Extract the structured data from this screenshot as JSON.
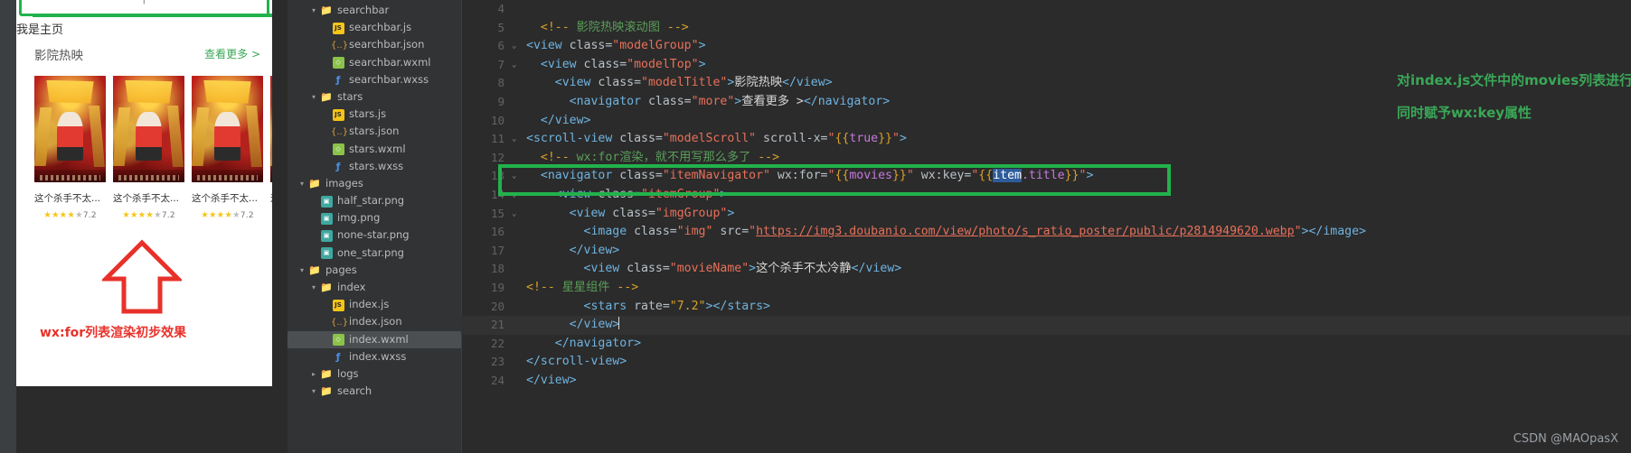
{
  "simulator": {
    "search_placeholder": "",
    "search_icon": "search-icon",
    "home_label": "我是主页",
    "model_title": "影院热映",
    "more_label": "查看更多 >",
    "movies": [
      {
        "title": "这个杀手不太...",
        "rate": "7.2"
      },
      {
        "title": "这个杀手不太...",
        "rate": "7.2"
      },
      {
        "title": "这个杀手不太...",
        "rate": "7.2"
      },
      {
        "title": "这",
        "rate": ""
      }
    ],
    "stars_filled": 4,
    "stars_empty": 1,
    "annotation": "wx:for列表渲染初步效果"
  },
  "explorer": {
    "items": [
      {
        "label": "searchbar",
        "indent": 1,
        "type": "folder",
        "arrow": "▾",
        "selected": false
      },
      {
        "label": "searchbar.js",
        "indent": 2,
        "type": "js",
        "arrow": "",
        "selected": false
      },
      {
        "label": "searchbar.json",
        "indent": 2,
        "type": "json",
        "arrow": "",
        "selected": false
      },
      {
        "label": "searchbar.wxml",
        "indent": 2,
        "type": "wxml",
        "arrow": "",
        "selected": false
      },
      {
        "label": "searchbar.wxss",
        "indent": 2,
        "type": "wxss",
        "arrow": "",
        "selected": false
      },
      {
        "label": "stars",
        "indent": 1,
        "type": "folder",
        "arrow": "▾",
        "selected": false
      },
      {
        "label": "stars.js",
        "indent": 2,
        "type": "js",
        "arrow": "",
        "selected": false
      },
      {
        "label": "stars.json",
        "indent": 2,
        "type": "json",
        "arrow": "",
        "selected": false
      },
      {
        "label": "stars.wxml",
        "indent": 2,
        "type": "wxml",
        "arrow": "",
        "selected": false
      },
      {
        "label": "stars.wxss",
        "indent": 2,
        "type": "wxss",
        "arrow": "",
        "selected": false
      },
      {
        "label": "images",
        "indent": 0,
        "type": "folder-t",
        "arrow": "▾",
        "selected": false
      },
      {
        "label": "half_star.png",
        "indent": 1,
        "type": "png",
        "arrow": "",
        "selected": false
      },
      {
        "label": "img.png",
        "indent": 1,
        "type": "png",
        "arrow": "",
        "selected": false
      },
      {
        "label": "none-star.png",
        "indent": 1,
        "type": "png",
        "arrow": "",
        "selected": false
      },
      {
        "label": "one_star.png",
        "indent": 1,
        "type": "png",
        "arrow": "",
        "selected": false
      },
      {
        "label": "pages",
        "indent": 0,
        "type": "folder-r",
        "arrow": "▾",
        "selected": false
      },
      {
        "label": "index",
        "indent": 1,
        "type": "folder",
        "arrow": "▾",
        "selected": false
      },
      {
        "label": "index.js",
        "indent": 2,
        "type": "js",
        "arrow": "",
        "selected": false
      },
      {
        "label": "index.json",
        "indent": 2,
        "type": "json",
        "arrow": "",
        "selected": false
      },
      {
        "label": "index.wxml",
        "indent": 2,
        "type": "wxml",
        "arrow": "",
        "selected": true
      },
      {
        "label": "index.wxss",
        "indent": 2,
        "type": "wxss",
        "arrow": "",
        "selected": false
      },
      {
        "label": "logs",
        "indent": 1,
        "type": "folder-y",
        "arrow": "▸",
        "selected": false
      },
      {
        "label": "search",
        "indent": 1,
        "type": "folder",
        "arrow": "▾",
        "selected": false
      }
    ]
  },
  "editor": {
    "lines": [
      {
        "n": "4",
        "fold": "",
        "cursor": false,
        "parts": []
      },
      {
        "n": "5",
        "fold": "",
        "cursor": false,
        "parts": [
          {
            "t": "  ",
            "c": "k-txt"
          },
          {
            "t": "<!-- ",
            "c": "k-cmt-mark"
          },
          {
            "t": "影院热映滚动图",
            "c": "k-cmt"
          },
          {
            "t": " -->",
            "c": "k-cmt-mark"
          }
        ]
      },
      {
        "n": "6",
        "fold": "⌄",
        "cursor": false,
        "parts": [
          {
            "t": "<view ",
            "c": "k-tag"
          },
          {
            "t": "class=",
            "c": "k-attr"
          },
          {
            "t": "\"modelGroup\"",
            "c": "k-str"
          },
          {
            "t": ">",
            "c": "k-tag"
          }
        ]
      },
      {
        "n": "7",
        "fold": "⌄",
        "cursor": false,
        "parts": [
          {
            "t": "  <view ",
            "c": "k-tag"
          },
          {
            "t": "class=",
            "c": "k-attr"
          },
          {
            "t": "\"modelTop\"",
            "c": "k-str"
          },
          {
            "t": ">",
            "c": "k-tag"
          }
        ]
      },
      {
        "n": "8",
        "fold": "",
        "cursor": false,
        "parts": [
          {
            "t": "    <view ",
            "c": "k-tag"
          },
          {
            "t": "class=",
            "c": "k-attr"
          },
          {
            "t": "\"modelTitle\"",
            "c": "k-str"
          },
          {
            "t": ">",
            "c": "k-tag"
          },
          {
            "t": "影院热映",
            "c": "k-txt"
          },
          {
            "t": "</view>",
            "c": "k-tag"
          }
        ]
      },
      {
        "n": "9",
        "fold": "",
        "cursor": false,
        "parts": [
          {
            "t": "      <navigator ",
            "c": "k-tag"
          },
          {
            "t": "class=",
            "c": "k-attr"
          },
          {
            "t": "\"more\"",
            "c": "k-str"
          },
          {
            "t": ">",
            "c": "k-tag"
          },
          {
            "t": "查看更多 >",
            "c": "k-txt"
          },
          {
            "t": "</navigator>",
            "c": "k-tag"
          }
        ]
      },
      {
        "n": "10",
        "fold": "",
        "cursor": false,
        "parts": [
          {
            "t": "  </view>",
            "c": "k-tag"
          }
        ]
      },
      {
        "n": "11",
        "fold": "⌄",
        "cursor": false,
        "parts": [
          {
            "t": "<scroll-view ",
            "c": "k-tag"
          },
          {
            "t": "class=",
            "c": "k-attr"
          },
          {
            "t": "\"modelScroll\"",
            "c": "k-str"
          },
          {
            "t": " scroll-x=",
            "c": "k-attr"
          },
          {
            "t": "\"",
            "c": "k-str"
          },
          {
            "t": "{{",
            "c": "k-brace"
          },
          {
            "t": "true",
            "c": "k-expr"
          },
          {
            "t": "}}",
            "c": "k-brace"
          },
          {
            "t": "\"",
            "c": "k-str"
          },
          {
            "t": ">",
            "c": "k-tag"
          }
        ]
      },
      {
        "n": "12",
        "fold": "",
        "cursor": false,
        "parts": [
          {
            "t": "  ",
            "c": "k-txt"
          },
          {
            "t": "<!-- ",
            "c": "k-cmt-mark"
          },
          {
            "t": "wx:for渲染，就不用写那么多了",
            "c": "k-cmt"
          },
          {
            "t": " -->",
            "c": "k-cmt-mark"
          }
        ]
      },
      {
        "n": "13",
        "fold": "⌄",
        "cursor": false,
        "parts": [
          {
            "t": "  <navigator ",
            "c": "k-tag"
          },
          {
            "t": "class=",
            "c": "k-attr"
          },
          {
            "t": "\"itemNavigator\"",
            "c": "k-str"
          },
          {
            "t": " wx:for=",
            "c": "k-attr"
          },
          {
            "t": "\"",
            "c": "k-str"
          },
          {
            "t": "{{",
            "c": "k-brace"
          },
          {
            "t": "movies",
            "c": "k-expr"
          },
          {
            "t": "}}",
            "c": "k-brace"
          },
          {
            "t": "\"",
            "c": "k-str"
          },
          {
            "t": " wx:key=",
            "c": "k-attr"
          },
          {
            "t": "\"",
            "c": "k-str"
          },
          {
            "t": "{{",
            "c": "k-brace"
          },
          {
            "t": "item",
            "c": "sel-blue"
          },
          {
            "t": ".title",
            "c": "k-expr"
          },
          {
            "t": "}}",
            "c": "k-brace"
          },
          {
            "t": "\"",
            "c": "k-str"
          },
          {
            "t": ">",
            "c": "k-tag"
          }
        ]
      },
      {
        "n": "14",
        "fold": "⌄",
        "cursor": false,
        "parts": [
          {
            "t": "    <view ",
            "c": "k-tag"
          },
          {
            "t": "class=",
            "c": "k-attr"
          },
          {
            "t": "\"itemGroup\"",
            "c": "k-str"
          },
          {
            "t": ">",
            "c": "k-tag"
          }
        ]
      },
      {
        "n": "15",
        "fold": "⌄",
        "cursor": false,
        "parts": [
          {
            "t": "      <view ",
            "c": "k-tag"
          },
          {
            "t": "class=",
            "c": "k-attr"
          },
          {
            "t": "\"imgGroup\"",
            "c": "k-str"
          },
          {
            "t": ">",
            "c": "k-tag"
          }
        ]
      },
      {
        "n": "16",
        "fold": "",
        "cursor": false,
        "parts": [
          {
            "t": "        <image ",
            "c": "k-tag"
          },
          {
            "t": "class=",
            "c": "k-attr"
          },
          {
            "t": "\"img\"",
            "c": "k-str"
          },
          {
            "t": " src=",
            "c": "k-attr"
          },
          {
            "t": "\"",
            "c": "k-str"
          },
          {
            "t": "https://img3.doubanio.com/view/photo/s_ratio_poster/public/p2814949620.webp",
            "c": "k-url"
          },
          {
            "t": "\"",
            "c": "k-str"
          },
          {
            "t": "></image>",
            "c": "k-tag"
          }
        ]
      },
      {
        "n": "17",
        "fold": "",
        "cursor": false,
        "parts": [
          {
            "t": "      </view>",
            "c": "k-tag"
          }
        ]
      },
      {
        "n": "18",
        "fold": "",
        "cursor": false,
        "parts": [
          {
            "t": "        <view ",
            "c": "k-tag"
          },
          {
            "t": "class=",
            "c": "k-attr"
          },
          {
            "t": "\"movieName\"",
            "c": "k-str"
          },
          {
            "t": ">",
            "c": "k-tag"
          },
          {
            "t": "这个杀手不太冷静",
            "c": "k-txt"
          },
          {
            "t": "</view>",
            "c": "k-tag"
          }
        ]
      },
      {
        "n": "19",
        "fold": "",
        "cursor": false,
        "parts": [
          {
            "t": "",
            "c": "k-txt"
          },
          {
            "t": "<!-- ",
            "c": "k-cmt-mark"
          },
          {
            "t": "星星组件",
            "c": "k-cmt"
          },
          {
            "t": " -->",
            "c": "k-cmt-mark"
          }
        ]
      },
      {
        "n": "20",
        "fold": "",
        "cursor": false,
        "parts": [
          {
            "t": "        <stars ",
            "c": "k-tag"
          },
          {
            "t": "rate=",
            "c": "k-attr"
          },
          {
            "t": "\"7.2\"",
            "c": "k-num"
          },
          {
            "t": "></stars>",
            "c": "k-tag"
          }
        ]
      },
      {
        "n": "21",
        "fold": "",
        "cursor": true,
        "parts": [
          {
            "t": "      </view>",
            "c": "k-tag"
          },
          {
            "t": "|caret|",
            "c": "caret"
          }
        ]
      },
      {
        "n": "22",
        "fold": "",
        "cursor": false,
        "parts": [
          {
            "t": "    </navigator>",
            "c": "k-tag"
          }
        ]
      },
      {
        "n": "23",
        "fold": "",
        "cursor": false,
        "parts": [
          {
            "t": "</scroll-view>",
            "c": "k-tag"
          }
        ]
      },
      {
        "n": "24",
        "fold": "",
        "cursor": false,
        "parts": [
          {
            "t": "</view>",
            "c": "k-tag"
          }
        ]
      }
    ],
    "note1": "对index.js文件中的movies列表进行渲染",
    "note2": "同时赋予wx:key属性"
  },
  "watermark": "CSDN @MAOpasX",
  "colors": {
    "accent_green": "#22b24c",
    "note_green": "#3aa757",
    "annotation_red": "#e8312a",
    "editor_bg": "#2b2b2b",
    "panel_bg": "#313335",
    "star_gold": "#f5c518",
    "selection_blue": "#2e5c9a"
  }
}
